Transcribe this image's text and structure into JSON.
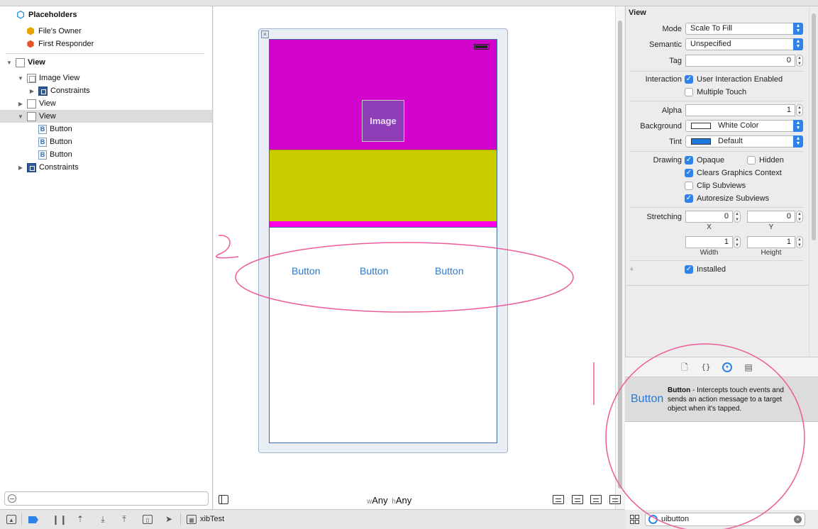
{
  "outline": {
    "placeholders": "Placeholders",
    "files_owner": "File's Owner",
    "first_responder": "First Responder",
    "root_view": "View",
    "image_view": "Image View",
    "constraints": "Constraints",
    "view_a": "View",
    "view_b": "View",
    "buttons": [
      "Button",
      "Button",
      "Button"
    ],
    "root_constraints": "Constraints",
    "button_icon_letter": "B"
  },
  "canvas": {
    "image_label": "Image",
    "buttons": [
      "Button",
      "Button",
      "Button"
    ],
    "size_class_w_prefix": "w",
    "size_class_w": "Any",
    "size_class_h_prefix": "h",
    "size_class_h": "Any",
    "colors": {
      "magenta": "#d203cc",
      "olive": "#c9cd00",
      "pink": "#ff00e6",
      "button_text": "#2a7ad5"
    }
  },
  "inspector": {
    "section_title": "View",
    "mode_label": "Mode",
    "mode_value": "Scale To Fill",
    "semantic_label": "Semantic",
    "semantic_value": "Unspecified",
    "tag_label": "Tag",
    "tag_value": "0",
    "interaction_label": "Interaction",
    "user_interaction": "User Interaction Enabled",
    "multiple_touch": "Multiple Touch",
    "alpha_label": "Alpha",
    "alpha_value": "1",
    "background_label": "Background",
    "background_value": "White Color",
    "tint_label": "Tint",
    "tint_value": "Default",
    "drawing_label": "Drawing",
    "opaque": "Opaque",
    "hidden": "Hidden",
    "clears_graphics": "Clears Graphics Context",
    "clip_subviews": "Clip Subviews",
    "autoresize_subviews": "Autoresize Subviews",
    "stretching_label": "Stretching",
    "stretch_x": "0",
    "stretch_y": "0",
    "x_label": "X",
    "y_label": "Y",
    "stretch_width": "1",
    "stretch_height": "1",
    "width_label": "Width",
    "height_label": "Height",
    "installed": "Installed",
    "plus": "+",
    "checked": {
      "user_interaction": true,
      "multiple_touch": false,
      "opaque": true,
      "hidden": false,
      "clears_graphics": true,
      "clip_subviews": false,
      "autoresize_subviews": true,
      "installed": true
    }
  },
  "library": {
    "item_title": "Button",
    "item_name": "Button",
    "item_desc": " - Intercepts touch events and sends an action message to a target object when it's tapped.",
    "search_value": "uibutton"
  },
  "bottombar": {
    "scheme": "xibTest"
  }
}
